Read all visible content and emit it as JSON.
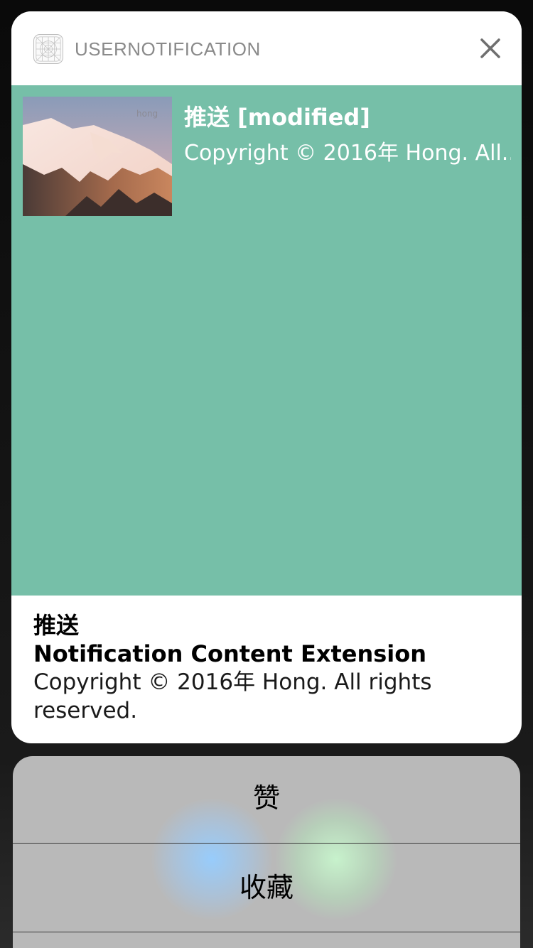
{
  "notification": {
    "app_name": "USERNOTIFICATION",
    "app_icon": "grid-icon",
    "close_icon": "close-icon"
  },
  "extension": {
    "background": "#76bfa8",
    "image_caption": "hong",
    "title": "推送 [modified]",
    "body": "Copyright © 2016年 Hong. All..."
  },
  "content": {
    "title": "推送",
    "subtitle": "Notification Content Extension",
    "body": "Copyright © 2016年 Hong. All rights reserved."
  },
  "actions": [
    {
      "label": "赞"
    },
    {
      "label": "收藏"
    }
  ]
}
